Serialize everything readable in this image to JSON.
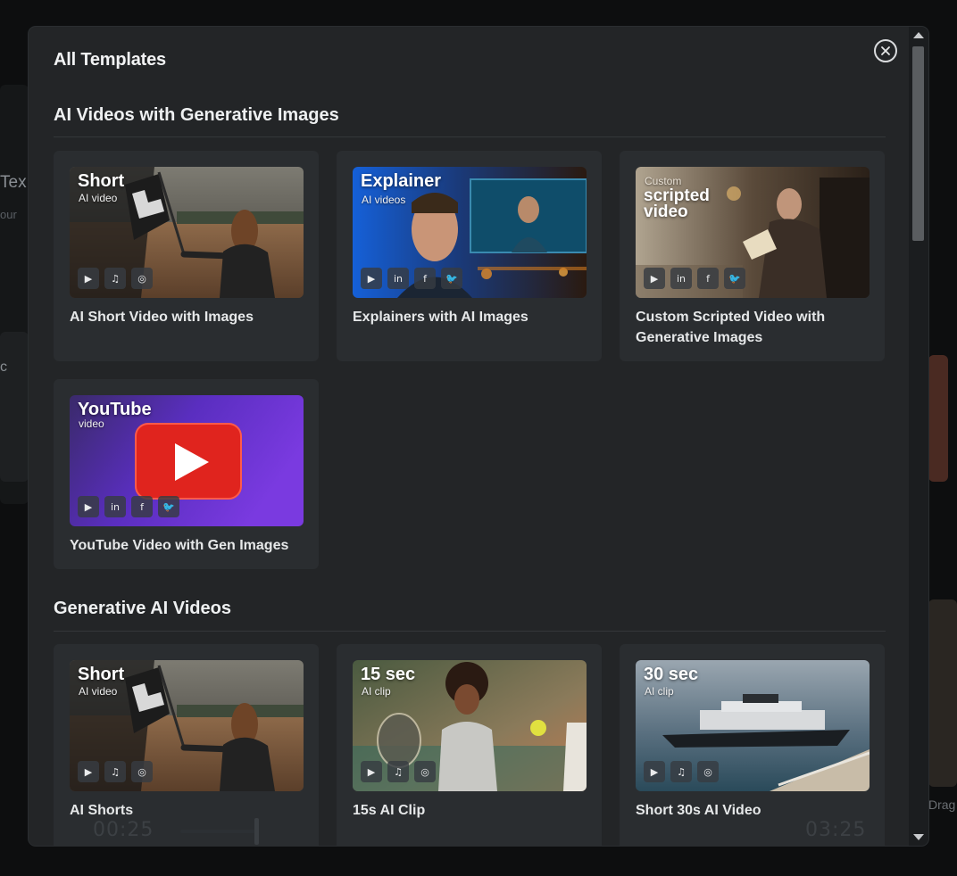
{
  "modal": {
    "title": "All Templates",
    "close_icon": "close-circle-icon"
  },
  "background": {
    "left_title_fragment": "Tex",
    "left_sub_fragment": "our",
    "left_letter_fragment": "c",
    "right_fragment": "Drag",
    "player": {
      "current_time": "00:25",
      "total_time": "03:25"
    }
  },
  "sections": [
    {
      "title": "AI Videos with Generative Images",
      "cards": [
        {
          "title": "Short",
          "subtitle": "AI video",
          "label": "AI Short Video with Images",
          "icons": [
            "youtube-icon",
            "tiktok-icon",
            "instagram-icon"
          ],
          "scene": "racing-flag"
        },
        {
          "title": "Explainer",
          "subtitle": "AI videos",
          "label": "Explainers with AI Images",
          "icons": [
            "youtube-icon",
            "linkedin-icon",
            "facebook-icon",
            "twitter-icon"
          ],
          "scene": "news-screen"
        },
        {
          "title_small": "Custom",
          "title_line1": "scripted",
          "title_line2": "video",
          "label": "Custom Scripted Video with Generative Images",
          "icons": [
            "youtube-icon",
            "linkedin-icon",
            "facebook-icon",
            "twitter-icon"
          ],
          "scene": "reading-man"
        },
        {
          "title": "YouTube",
          "subtitle": "video",
          "label": "YouTube Video with Gen Images",
          "icons": [
            "youtube-icon",
            "linkedin-icon",
            "facebook-icon",
            "twitter-icon"
          ],
          "scene": "youtube-logo"
        }
      ]
    },
    {
      "title": "Generative AI Videos",
      "cards": [
        {
          "title": "Short",
          "subtitle": "AI video",
          "label": "AI Shorts",
          "icons": [
            "youtube-icon",
            "tiktok-icon",
            "instagram-icon"
          ],
          "scene": "racing-flag"
        },
        {
          "title": "15 sec",
          "subtitle": "AI clip",
          "label": "15s AI Clip",
          "icons": [
            "youtube-icon",
            "tiktok-icon",
            "instagram-icon"
          ],
          "scene": "tennis"
        },
        {
          "title": "30 sec",
          "subtitle": "AI clip",
          "label": "Short 30s AI Video",
          "icons": [
            "youtube-icon",
            "tiktok-icon",
            "instagram-icon"
          ],
          "scene": "cruise-ship"
        }
      ]
    }
  ],
  "icon_glyphs": {
    "youtube": "▶",
    "tiktok": "♫",
    "instagram": "◎",
    "linkedin": "in",
    "facebook": "f",
    "twitter": "🐦"
  },
  "colors": {
    "modal_bg": "#232527",
    "card_bg": "#2a2d30",
    "youtube_red": "#e0241e",
    "purple": "#6a35d6",
    "blue": "#1a6fe0"
  }
}
